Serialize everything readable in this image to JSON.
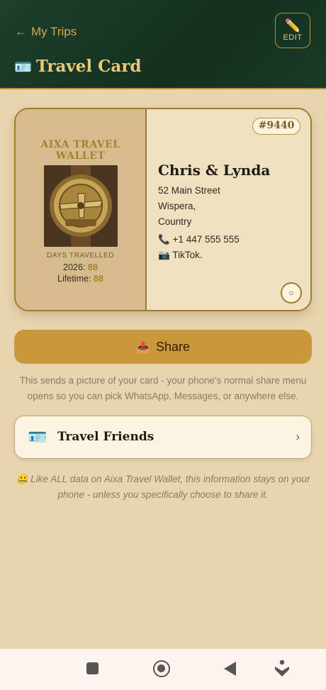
{
  "header": {
    "back_label": "My Trips",
    "back_arrow": "←",
    "edit_label": "EDIT",
    "edit_icon": "✏️",
    "title": "Travel Card",
    "title_icon": "🪪"
  },
  "card": {
    "brand": "AIXA TRAVEL WALLET",
    "days_label": "DAYS TRAVELLED",
    "year_label": "2026:",
    "year_days": "88",
    "lifetime_label": "Lifetime:",
    "lifetime_days": "88",
    "id": "#9440",
    "name": "Chris & Lynda",
    "address_line1": "52 Main Street",
    "address_line2": "Wispera,",
    "address_line3": "Country",
    "phone_icon": "📞",
    "phone": "+1 447 555 555",
    "social_icon": "📷",
    "social": "TikTok.",
    "circle_icon": "○"
  },
  "share": {
    "icon": "📤",
    "label": "Share",
    "note": "This sends a picture of your card - your phone's normal share menu opens so you can pick WhatsApp, Messages, or anywhere else."
  },
  "friends": {
    "icon": "🪪",
    "label": "Travel Friends",
    "chevron": "›"
  },
  "privacy": {
    "emoji": "🤐",
    "text": "Like ALL data on Aixa Travel Wallet, this information stays on your phone - unless you specifically choose to share it."
  },
  "colors": {
    "header_bg": "#1d3f2c",
    "accent_gold": "#c9983a",
    "page_bg": "#e8d5b0"
  }
}
